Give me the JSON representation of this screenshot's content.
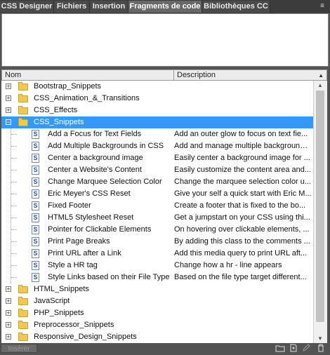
{
  "tabs": [
    {
      "label": "CSS Designer"
    },
    {
      "label": "Fichiers"
    },
    {
      "label": "Insertion"
    },
    {
      "label": "Fragments de code"
    },
    {
      "label": "Bibliothèques CC"
    }
  ],
  "columns": {
    "name": "Nom",
    "description": "Description"
  },
  "items": [
    {
      "label": "Bootstrap_Snippets",
      "desc": ""
    },
    {
      "label": "CSS_Animation_&_Transitions",
      "desc": ""
    },
    {
      "label": "CSS_Effects",
      "desc": ""
    },
    {
      "label": "CSS_Snippets",
      "desc": ""
    },
    {
      "label": "Add a Focus for Text Fields",
      "desc": "Add an outer glow to focus on text fie..."
    },
    {
      "label": "Add Multiple Backgrounds in CSS",
      "desc": "Add and manage multiple background ..."
    },
    {
      "label": "Center a background image",
      "desc": "Easily center a background image for ..."
    },
    {
      "label": "Center a Website's Content",
      "desc": "Easily customize the content area and..."
    },
    {
      "label": "Change Marquee Selection Color",
      "desc": "Change the marquee selection color u..."
    },
    {
      "label": "Eric Meyer's CSS Reset",
      "desc": "Give your self a quick start with Eric M..."
    },
    {
      "label": "Fixed Footer",
      "desc": "Create a footer that is fixed to the bo..."
    },
    {
      "label": "HTML5 Stylesheet Reset",
      "desc": "Get a jumpstart on your CSS using thi..."
    },
    {
      "label": "Pointer for Clickable Elements",
      "desc": "On hovering over clickable elements, ..."
    },
    {
      "label": "Print Page Breaks",
      "desc": "By adding this class to the comments ..."
    },
    {
      "label": "Print URL after a Link",
      "desc": "Add this media query to print URL aft..."
    },
    {
      "label": "Style a HR tag",
      "desc": "Change how a hr - line appears"
    },
    {
      "label": "Style Links based on their File Type",
      "desc": "Based on the file type target different..."
    },
    {
      "label": "HTML_Snippets",
      "desc": ""
    },
    {
      "label": "JavaScript",
      "desc": ""
    },
    {
      "label": "PHP_Snippets",
      "desc": ""
    },
    {
      "label": "Preprocessor_Snippets",
      "desc": ""
    },
    {
      "label": "Responsive_Design_Snippets",
      "desc": ""
    }
  ],
  "footer": {
    "insert_label": "Insérer"
  },
  "colors": {
    "selection": "#3399ff",
    "panel": "#535353",
    "folder": "#f2c94c"
  },
  "icons": [
    "folder-icon",
    "snippet-icon",
    "new-folder-icon",
    "new-snippet-icon",
    "edit-icon",
    "delete-icon"
  ]
}
